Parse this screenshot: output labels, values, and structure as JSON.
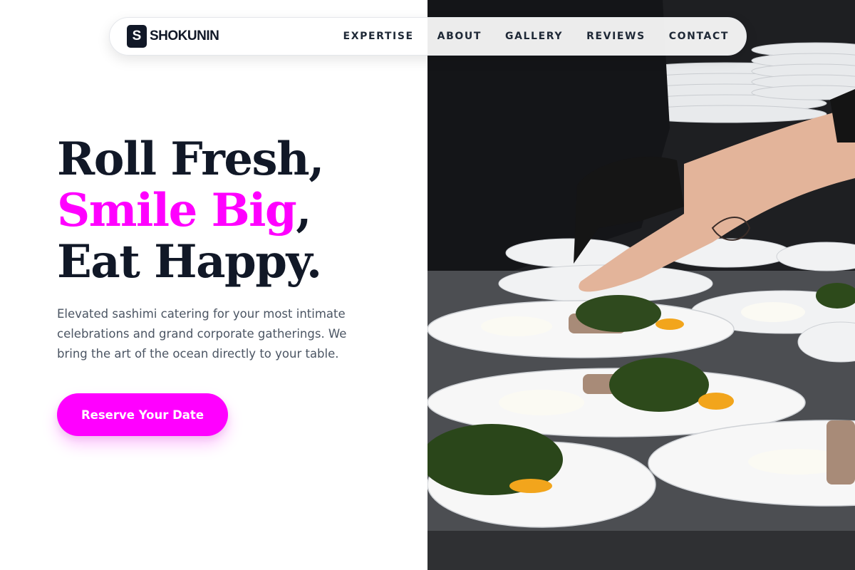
{
  "brand": {
    "mark": "S",
    "name": "SHOKUNIN"
  },
  "nav": {
    "items": [
      {
        "label": "EXPERTISE"
      },
      {
        "label": "ABOUT"
      },
      {
        "label": "GALLERY"
      },
      {
        "label": "REVIEWS"
      },
      {
        "label": "CONTACT"
      }
    ]
  },
  "hero": {
    "line1": "Roll Fresh,",
    "line2_accent": "Smile Big",
    "line2_suffix": ",",
    "line3": "Eat Happy.",
    "description": "Elevated sashimi catering for your most intimate celebrations and grand corporate gatherings. We bring the art of the ocean directly to your table.",
    "cta_label": "Reserve Your Date"
  },
  "colors": {
    "accent": "#ff00ff",
    "dark": "#111827",
    "body_text": "#4b5563"
  }
}
